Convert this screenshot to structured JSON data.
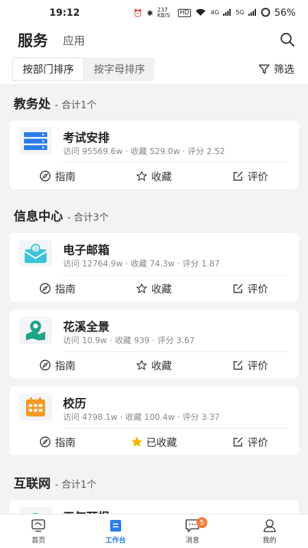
{
  "status_bar": {
    "time": "19:12",
    "net_speed": "237 KB/S",
    "hd": "HD",
    "signal1": "4G",
    "signal2": "5G",
    "battery": "56%"
  },
  "header": {
    "title": "服务",
    "tab": "应用"
  },
  "sort": {
    "by_department": "按部门排序",
    "by_letter": "按字母排序",
    "filter": "筛选"
  },
  "sections": [
    {
      "title": "教务处",
      "count": "- 合计1个",
      "items": [
        {
          "name": "考试安排",
          "stats": "访问 95569.6w · 收藏 529.0w · 评分 2.52",
          "guide": "指南",
          "fav": "收藏",
          "rate": "评价"
        }
      ]
    },
    {
      "title": "信息中心",
      "count": "- 合计3个",
      "items": [
        {
          "name": "电子邮箱",
          "stats": "访问 12764.9w · 收藏 74.3w · 评分 1.87",
          "guide": "指南",
          "fav": "收藏",
          "rate": "评价"
        },
        {
          "name": "花溪全景",
          "stats": "访问 10.9w · 收藏 939 · 评分 3.67",
          "guide": "指南",
          "fav": "收藏",
          "rate": "评价"
        },
        {
          "name": "校历",
          "stats": "访问 4798.1w · 收藏 100.4w · 评分 3.37",
          "guide": "指南",
          "fav": "已收藏",
          "rate": "评价"
        }
      ]
    },
    {
      "title": "互联网",
      "count": "- 合计1个",
      "items": [
        {
          "name": "天气预报"
        }
      ]
    }
  ],
  "bottom_nav": [
    {
      "label": "首页"
    },
    {
      "label": "工作台"
    },
    {
      "label": "消息",
      "badge": "5"
    },
    {
      "label": "我的"
    }
  ],
  "colors": {
    "accent": "#2b7de9",
    "badge": "#f0803a",
    "star_filled": "#f5b400"
  }
}
